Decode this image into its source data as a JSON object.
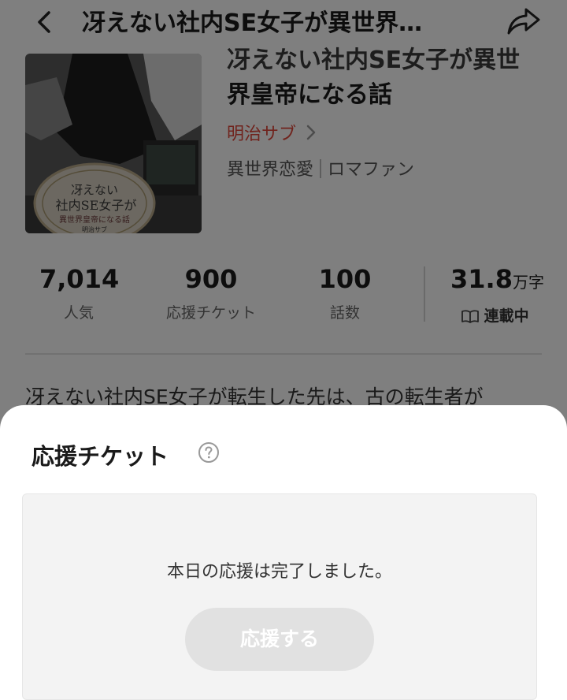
{
  "header": {
    "title": "冴えない社内SE女子が異世界…"
  },
  "book": {
    "title_line1": "冴えない社内SE女子が異世",
    "title_line2": "界皇帝になる話",
    "author": "明治サブ",
    "genres": [
      "異世界恋愛",
      "ロマファン"
    ],
    "cover": {
      "line1": "冴えない",
      "line2": "社内SE女子が",
      "line3": "異世界皇帝になる話",
      "author": "明治サブ"
    }
  },
  "stats": {
    "popularity": {
      "value": "7,014",
      "label": "人気"
    },
    "tickets": {
      "value": "900",
      "label": "応援チケット"
    },
    "episodes": {
      "value": "100",
      "label": "話数"
    },
    "word_count": {
      "value": "31.8",
      "unit": "万字",
      "status": "連載中"
    }
  },
  "synopsis": "冴えない社内SE女子が転生した先は、古の転生者が",
  "sheet": {
    "title": "応援チケット",
    "message": "本日の応援は完了しました。",
    "button_label": "応援する"
  },
  "icons": {
    "back": "chevron-left-icon",
    "share": "share-arrow-icon",
    "help": "question-circle-icon",
    "book": "open-book-icon"
  },
  "colors": {
    "author": "#e0473a",
    "overlay": "rgba(0,0,0,0.5)",
    "button_disabled": "#e1e1e1"
  }
}
